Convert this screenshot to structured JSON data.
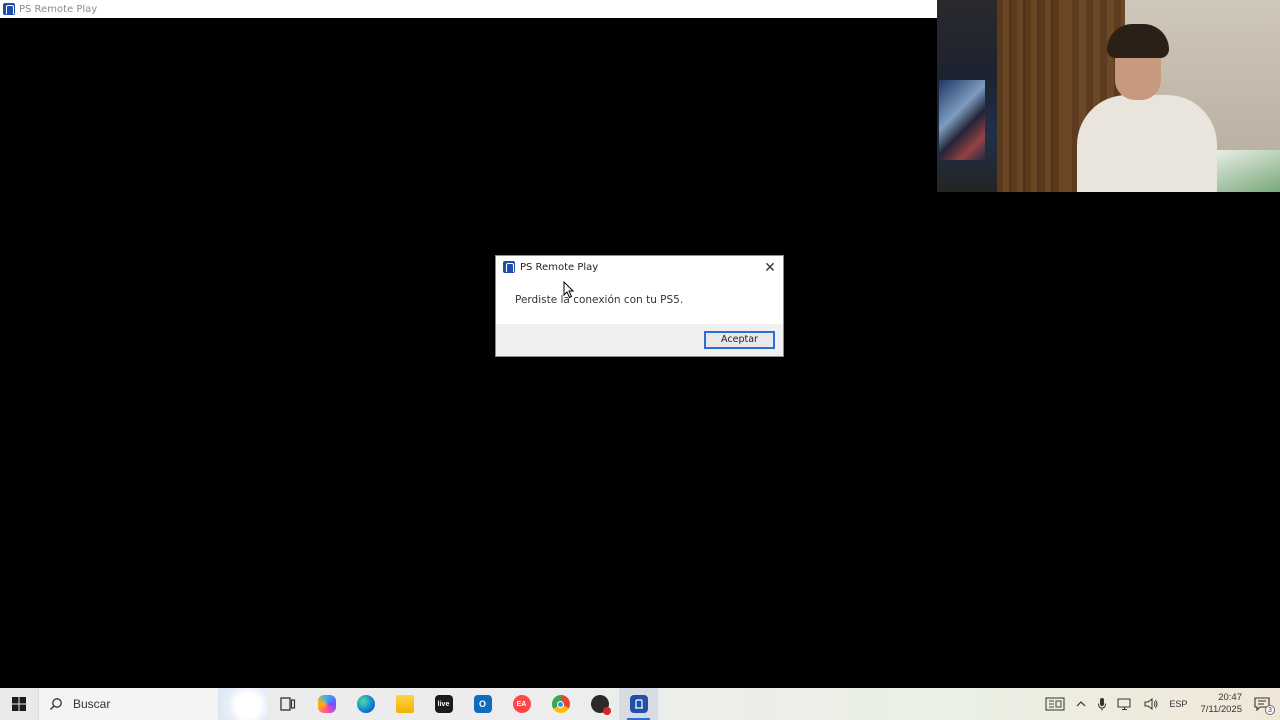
{
  "app_window": {
    "title": "PS Remote Play"
  },
  "dialog": {
    "title": "PS Remote Play",
    "message": "Perdiste la conexión con tu PS5.",
    "ok_label": "Aceptar",
    "close_glyph": "✕"
  },
  "taskbar": {
    "search_placeholder": "Buscar",
    "apps": [
      {
        "name": "task-view-icon",
        "label": ""
      },
      {
        "name": "copilot-icon",
        "label": ""
      },
      {
        "name": "edge-icon",
        "label": ""
      },
      {
        "name": "file-explorer-icon",
        "label": ""
      },
      {
        "name": "livestream-icon",
        "label": "live"
      },
      {
        "name": "outlook-icon",
        "label": "O"
      },
      {
        "name": "ea-app-icon",
        "label": "EA"
      },
      {
        "name": "chrome-icon",
        "label": ""
      },
      {
        "name": "obs-icon",
        "label": ""
      },
      {
        "name": "ps-remote-play-icon",
        "label": ""
      }
    ],
    "tray": {
      "language": "ESP",
      "time": "20:47",
      "date": "7/11/2025",
      "notification_count": "3"
    }
  },
  "colors": {
    "accent": "#2b6fd6",
    "ps_blue": "#1f4fa8"
  }
}
